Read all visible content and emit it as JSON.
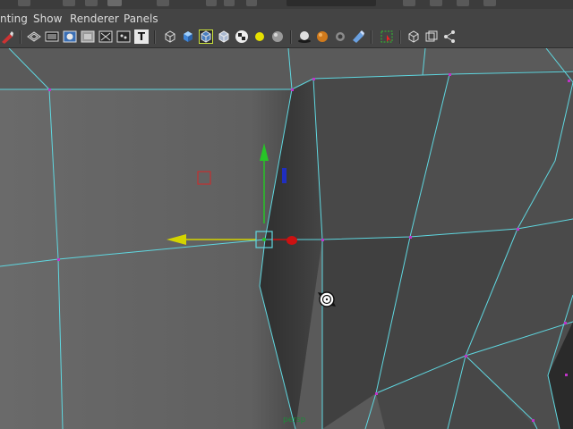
{
  "menu": {
    "items": [
      {
        "label": "nting"
      },
      {
        "label": "Show"
      },
      {
        "label": "Renderer"
      },
      {
        "label": "Panels"
      }
    ]
  },
  "toolbar": {
    "icons": [
      "select-camera-icon",
      "wireframe-icon",
      "smooth-shade-icon",
      "bounding-box-icon",
      "flat-shade-icon",
      "x-ray-icon",
      "textured-icon",
      "text-label-icon",
      "wireframe-cube-icon",
      "shaded-cube-icon",
      "wireframe-on-shaded-icon",
      "xray-cube-icon",
      "checker-icon",
      "default-light-icon",
      "all-lights-icon",
      "shadows-icon",
      "ambient-occlusion-icon",
      "motion-blur-icon",
      "multisample-icon",
      "isolate-select-icon",
      "grid-icon",
      "resolution-gate-icon",
      "gate-mask-icon"
    ],
    "text_icon_glyph": "T"
  },
  "viewport": {
    "camera_label": "persp",
    "wire_color": "#5fd7e0",
    "vertex_color": "#c033c8",
    "manipulator": {
      "x_axis_color": "#d4d400",
      "y_axis_color": "#27c427",
      "z_axis_color": "#cc1111"
    }
  }
}
